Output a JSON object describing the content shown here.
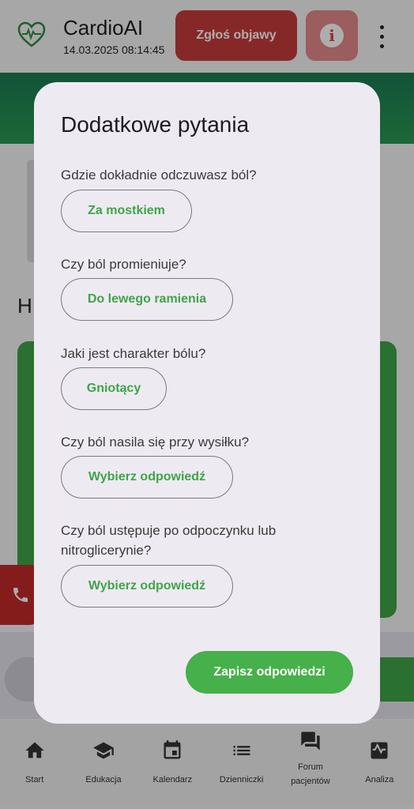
{
  "header": {
    "app_title": "CardioAI",
    "datetime": "14.03.2025 08:14:45",
    "report_button": "Zgłoś objawy",
    "info_icon": "info-icon",
    "more_icon": "more-vert-icon"
  },
  "background": {
    "section_letter": "H"
  },
  "dialog": {
    "title": "Dodatkowe pytania",
    "questions": [
      {
        "label": "Gdzie dokładnie odczuwasz ból?",
        "answer": "Za mostkiem"
      },
      {
        "label": "Czy ból promieniuje?",
        "answer": "Do lewego ramienia"
      },
      {
        "label": "Jaki jest charakter bólu?",
        "answer": "Gniotący"
      },
      {
        "label": "Czy ból nasila się przy wysiłku?",
        "answer": "Wybierz odpowiedź"
      },
      {
        "label": "Czy ból ustępuje po odpoczynku lub nitroglicerynie?",
        "answer": "Wybierz odpowiedź"
      }
    ],
    "save_button": "Zapisz odpowiedzi"
  },
  "nav": {
    "items": [
      {
        "label": "Start",
        "icon": "home-icon"
      },
      {
        "label": "Edukacja",
        "icon": "school-icon"
      },
      {
        "label": "Kalendarz",
        "icon": "calendar-icon"
      },
      {
        "label": "Dzienniczki",
        "icon": "list-icon"
      },
      {
        "label": "Forum pacjentów",
        "icon": "forum-icon"
      },
      {
        "label": "Analiza",
        "icon": "analytics-icon"
      }
    ]
  },
  "colors": {
    "accent_green": "#46b04a",
    "alert_red": "#c73b3b",
    "dialog_bg": "#eeeaf1"
  }
}
